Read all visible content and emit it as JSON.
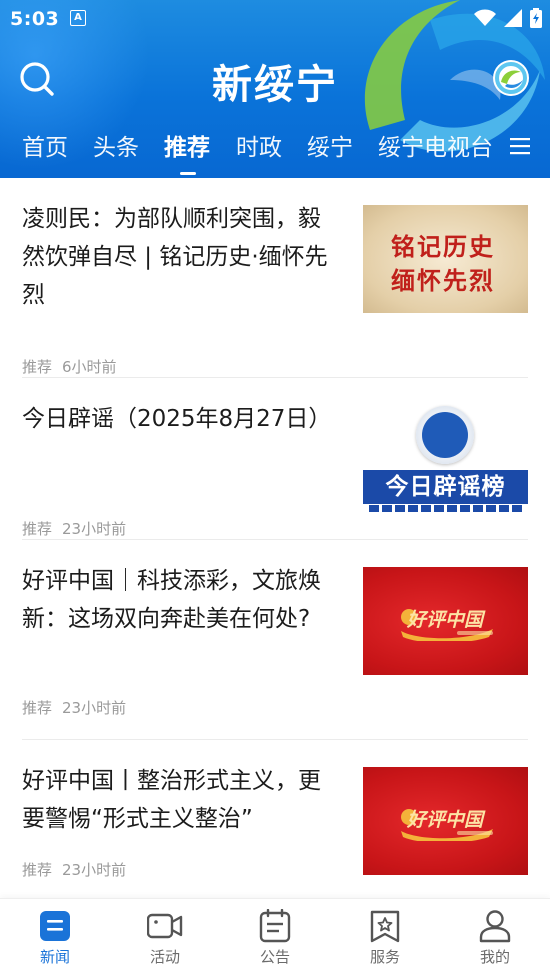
{
  "status_bar": {
    "time": "5:03",
    "notification_icon": "A"
  },
  "header": {
    "title": "新绥宁",
    "search_icon": "search-icon",
    "logo_icon": "app-logo-icon"
  },
  "tabs": [
    {
      "label": "首页",
      "active": false
    },
    {
      "label": "头条",
      "active": false
    },
    {
      "label": "推荐",
      "active": true
    },
    {
      "label": "时政",
      "active": false
    },
    {
      "label": "绥宁",
      "active": false
    },
    {
      "label": "绥宁电视台",
      "active": false
    }
  ],
  "feed": [
    {
      "title": "凌则民：为部队顺利突围，毅然饮弹自尽 | 铭记历史·缅怀先烈",
      "channel": "推荐",
      "time": "6小时前",
      "thumb_lines": [
        "铭记历史",
        "缅怀先烈"
      ]
    },
    {
      "title": "今日辟谣（2025年8月27日）",
      "channel": "推荐",
      "time": "23小时前",
      "thumb_text": "今日辟谣榜"
    },
    {
      "title": "好评中国｜科技添彩，文旅焕新：这场双向奔赴美在何处?",
      "channel": "推荐",
      "time": "23小时前",
      "thumb_text": "好评中国"
    },
    {
      "title": "好评中国丨整治形式主义，更要警惕“形式主义整治”",
      "channel": "推荐",
      "time": "23小时前",
      "thumb_text": "好评中国"
    }
  ],
  "bottom_nav": [
    {
      "label": "新闻",
      "icon": "news-icon",
      "active": true
    },
    {
      "label": "活动",
      "icon": "video-camera-icon",
      "active": false
    },
    {
      "label": "公告",
      "icon": "notice-icon",
      "active": false
    },
    {
      "label": "服务",
      "icon": "service-icon",
      "active": false
    },
    {
      "label": "我的",
      "icon": "profile-icon",
      "active": false
    }
  ],
  "colors": {
    "header_blue": "#0a73d9",
    "accent_blue": "#1a73d8",
    "thumb_red": "#c81518"
  }
}
